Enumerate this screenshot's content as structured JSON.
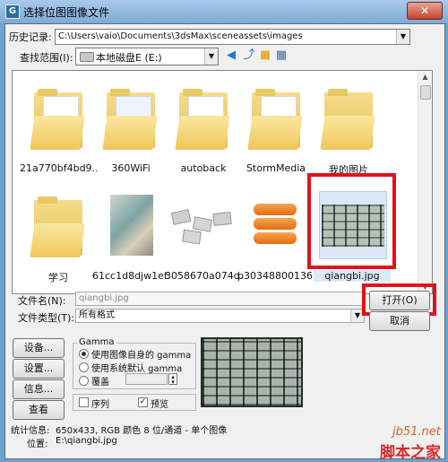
{
  "window": {
    "title": "选择位图图像文件",
    "close_glyph": "✕",
    "app_glyph": "G"
  },
  "history": {
    "label": "历史记录:",
    "value": "C:\\Users\\vaio\\Documents\\3dsMax\\sceneassets\\images"
  },
  "look_in": {
    "label": "查找范围(I):",
    "value": "本地磁盘E (E:)"
  },
  "files": [
    {
      "name": "21a770bf4bd9...",
      "type": "folder"
    },
    {
      "name": "360WiFi",
      "type": "folder"
    },
    {
      "name": "autoback",
      "type": "folder"
    },
    {
      "name": "StormMedia",
      "type": "folder"
    },
    {
      "name": "我的图片",
      "type": "folder"
    },
    {
      "name": "学习",
      "type": "folder"
    },
    {
      "name": "61cc1d8djw1ef...",
      "type": "image"
    },
    {
      "name": "3058670a074d...",
      "type": "image"
    },
    {
      "name": "p30348800136...",
      "type": "image"
    },
    {
      "name": "qiangbi.jpg",
      "type": "image",
      "selected": true
    }
  ],
  "filename": {
    "label": "文件名(N):",
    "value": "qiangbi.jpg"
  },
  "filetype": {
    "label": "文件类型(T):",
    "value": "所有格式"
  },
  "buttons": {
    "open": "打开(O)",
    "cancel": "取消",
    "setup": "设备...",
    "settings": "设置...",
    "info": "信息...",
    "view": "查看"
  },
  "gamma": {
    "title": "Gamma",
    "option_own": "使用图像自身的 gamma",
    "option_system": "使用系统默认 gamma",
    "option_override": "覆盖"
  },
  "sequence_label": "序列",
  "preview_label": "预览",
  "stats": {
    "label": "统计信息:",
    "value": "650x433, RGB 颜色 8 位/通道 - 单个图像"
  },
  "location": {
    "label": "位置:",
    "value": "E:\\qiangbi.jpg"
  },
  "watermark": {
    "site": "jb51.net",
    "name": "脚本之家"
  },
  "colors": {
    "highlight_box": "#e0131a",
    "title_bar": "#7eaad6"
  }
}
